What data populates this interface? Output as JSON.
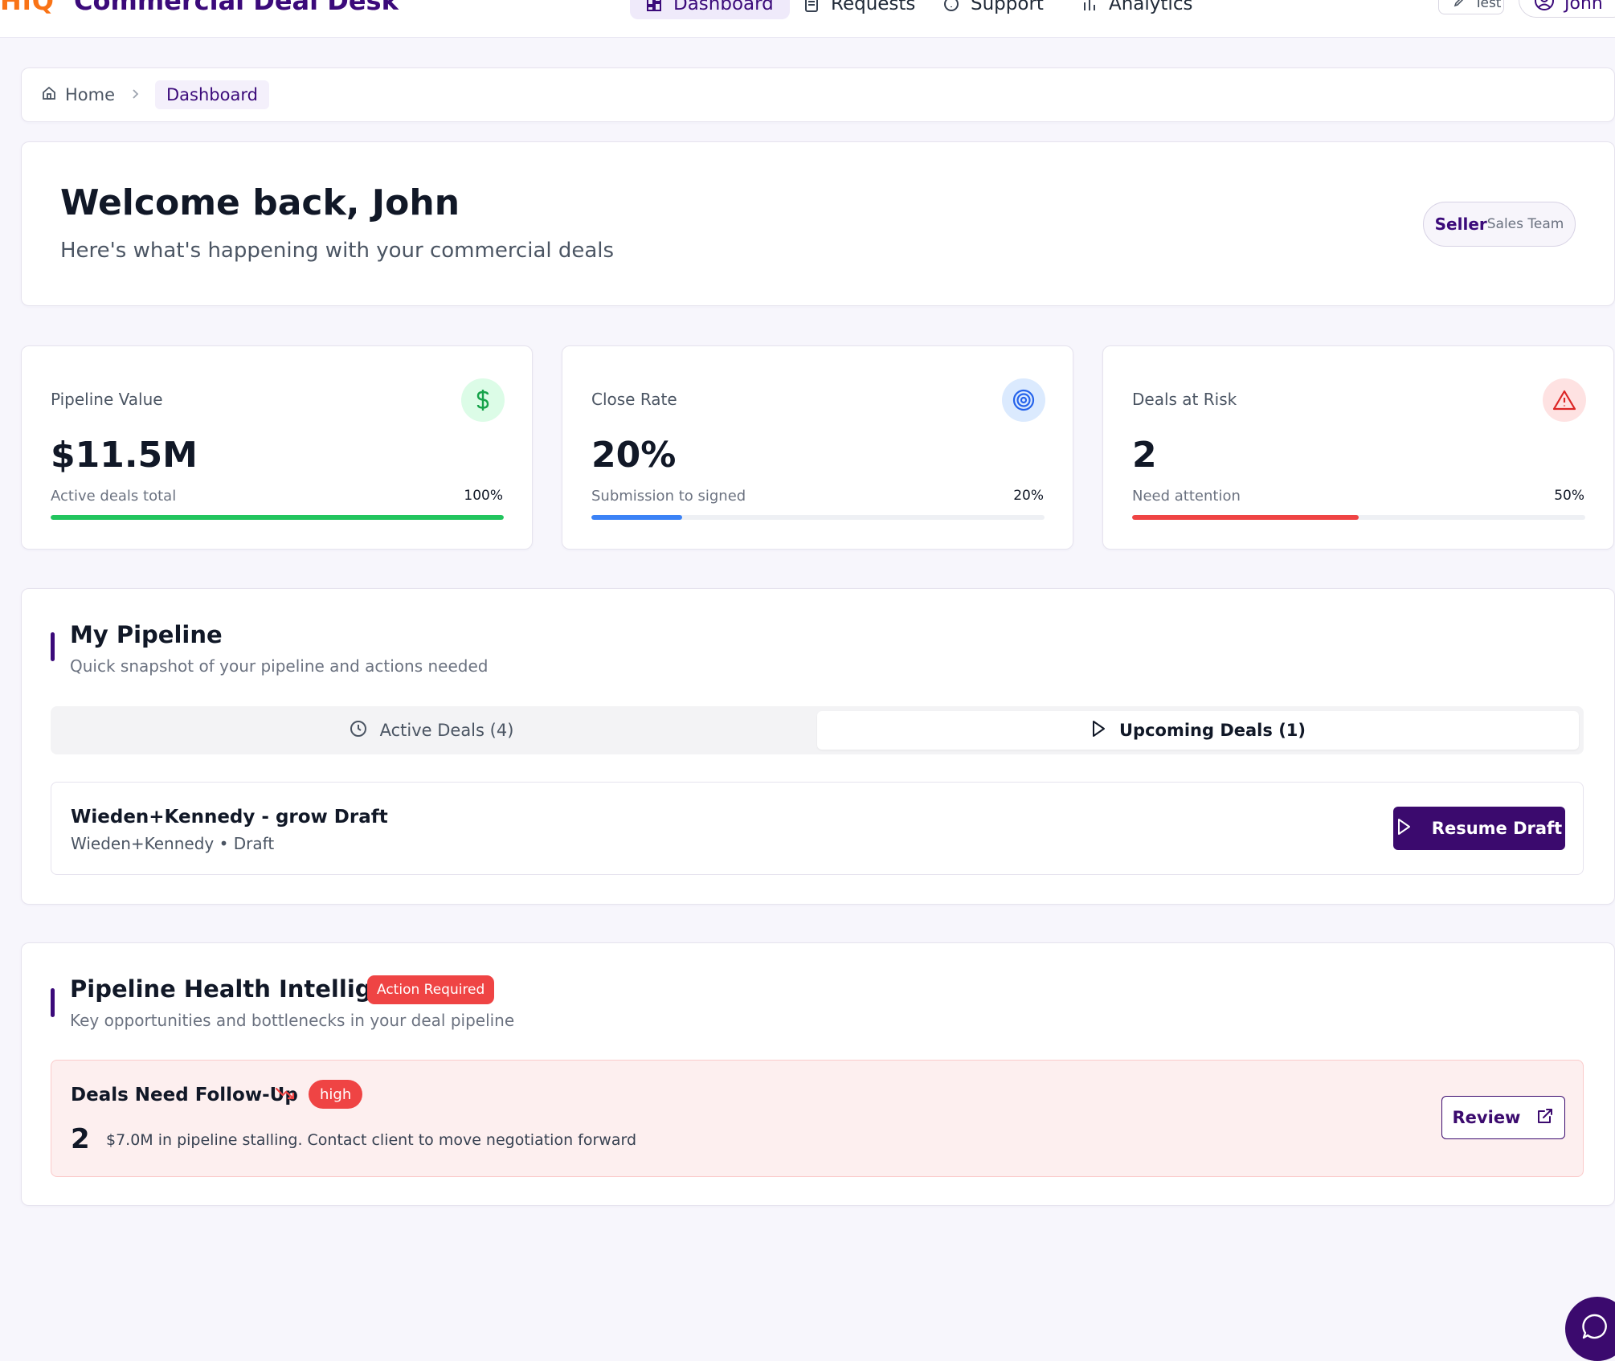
{
  "app": {
    "logo": "HiQ",
    "title": "Commercial Deal Desk"
  },
  "nav": {
    "items": [
      {
        "label": "Dashboard",
        "icon": "dashboard-icon",
        "active": true
      },
      {
        "label": "Requests",
        "icon": "document-icon",
        "active": false
      },
      {
        "label": "Support",
        "icon": "help-circle-icon",
        "active": false
      },
      {
        "label": "Analytics",
        "icon": "bar-chart-icon",
        "active": false
      }
    ],
    "test_label": "Test",
    "user_label": "John"
  },
  "breadcrumb": {
    "home": "Home",
    "current": "Dashboard"
  },
  "welcome": {
    "title": "Welcome back, John",
    "subtitle": "Here's what's happening with your commercial deals",
    "role_main": "Seller",
    "role_sub": "Sales Team"
  },
  "stats": [
    {
      "label": "Pipeline Value",
      "value": "$11.5M",
      "caption": "Active deals total",
      "percent_label": "100%",
      "progress": 1.0,
      "color": "#22c55e",
      "icon_bg": "#dcfce7",
      "icon": "dollar-icon"
    },
    {
      "label": "Close Rate",
      "value": "20%",
      "caption": "Submission to signed",
      "percent_label": "20%",
      "progress": 0.2,
      "color": "#3b82f6",
      "icon_bg": "#dbeafe",
      "icon": "target-icon"
    },
    {
      "label": "Deals at Risk",
      "value": "2",
      "caption": "Need attention",
      "percent_label": "50%",
      "progress": 0.5,
      "color": "#ef4444",
      "icon_bg": "#fee2e2",
      "icon": "alert-triangle-icon"
    }
  ],
  "pipeline": {
    "title": "My Pipeline",
    "subtitle": "Quick snapshot of your pipeline and actions needed",
    "tabs": [
      {
        "label": "Active Deals (4)",
        "icon": "clock-icon",
        "active": false
      },
      {
        "label": "Upcoming Deals (1)",
        "icon": "play-icon",
        "active": true
      }
    ],
    "deal": {
      "name": "Wieden+Kennedy - grow Draft",
      "meta": "Wieden+Kennedy • Draft",
      "action": "Resume Draft"
    }
  },
  "health": {
    "title": "Pipeline Health Intelligence",
    "badge": "Action Required",
    "subtitle": "Key opportunities and bottlenecks in your deal pipeline",
    "alert": {
      "title": "Deals Need Follow-Up",
      "priority": "high",
      "count": "2",
      "description": "$7.0M in pipeline stalling. Contact client to move negotiation forward",
      "action": "Review"
    }
  },
  "colors": {
    "brand": "#3b0a6e",
    "danger": "#ef4444",
    "logo": "#f97316"
  }
}
